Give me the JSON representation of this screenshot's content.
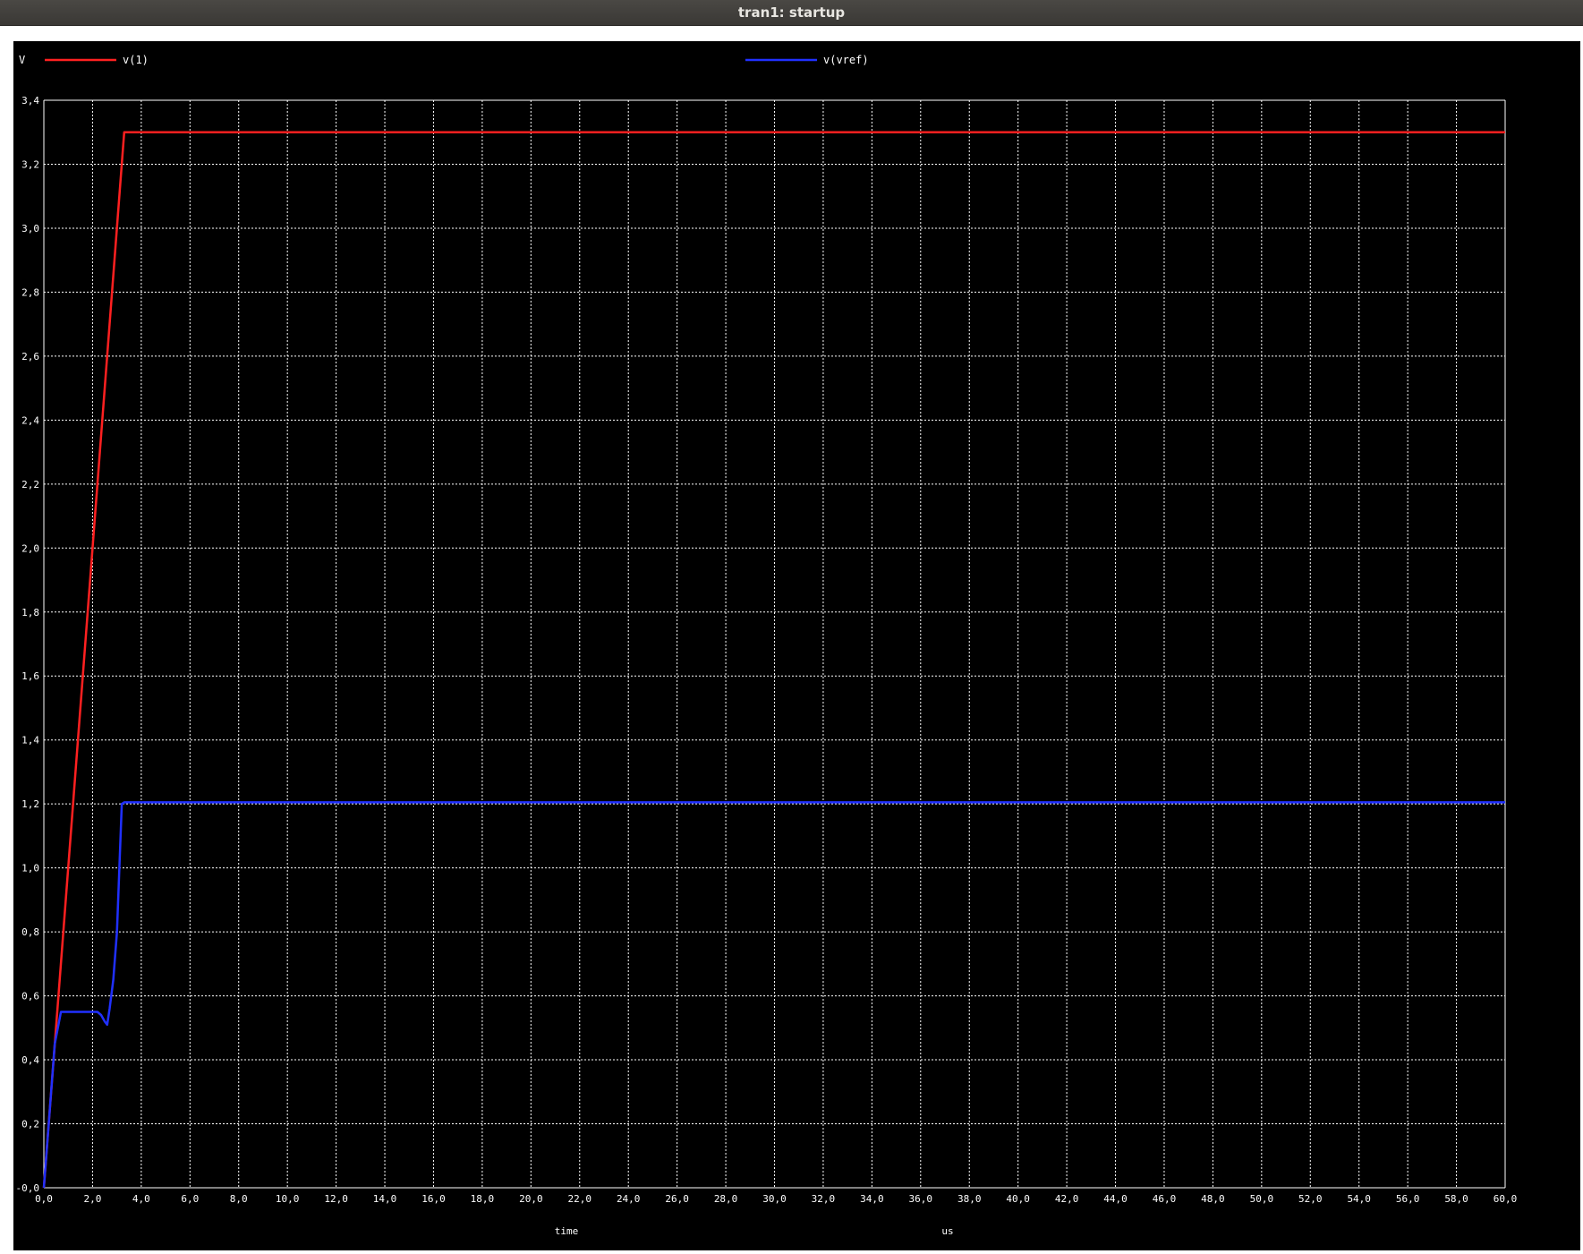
{
  "window": {
    "title": "tran1: startup"
  },
  "chart_data": {
    "type": "line",
    "ylabel": "V",
    "xlabel": "time",
    "xunit": "us",
    "xlim": [
      0,
      60
    ],
    "ylim": [
      0,
      3.4
    ],
    "x_ticks": [
      0,
      2,
      4,
      6,
      8,
      10,
      12,
      14,
      16,
      18,
      20,
      22,
      24,
      26,
      28,
      30,
      32,
      34,
      36,
      38,
      40,
      42,
      44,
      46,
      48,
      50,
      52,
      54,
      56,
      58,
      60
    ],
    "x_tick_labels": [
      "0,0",
      "2,0",
      "4,0",
      "6,0",
      "8,0",
      "10,0",
      "12,0",
      "14,0",
      "16,0",
      "18,0",
      "20,0",
      "22,0",
      "24,0",
      "26,0",
      "28,0",
      "30,0",
      "32,0",
      "34,0",
      "36,0",
      "38,0",
      "40,0",
      "42,0",
      "44,0",
      "46,0",
      "48,0",
      "50,0",
      "52,0",
      "54,0",
      "56,0",
      "58,0",
      "60,0"
    ],
    "y_ticks": [
      0,
      0.2,
      0.4,
      0.6,
      0.8,
      1.0,
      1.2,
      1.4,
      1.6,
      1.8,
      2.0,
      2.2,
      2.4,
      2.6,
      2.8,
      3.0,
      3.2,
      3.4
    ],
    "y_tick_labels": [
      "-0,0",
      "0,2",
      "0,4",
      "0,6",
      "0,8",
      "1,0",
      "1,2",
      "1,4",
      "1,6",
      "1,8",
      "2,0",
      "2,2",
      "2,4",
      "2,6",
      "2,8",
      "3,0",
      "3,2",
      "3,4"
    ],
    "grid": true,
    "colors": {
      "background": "#000000",
      "grid": "#ffffff",
      "axis_text": "#ffffff"
    },
    "series": [
      {
        "name": "v(1)",
        "color": "#ff2020",
        "x": [
          0,
          3.3,
          60
        ],
        "y": [
          0,
          3.3,
          3.3
        ]
      },
      {
        "name": "v(vref)",
        "color": "#2030ff",
        "x": [
          0,
          0.25,
          0.45,
          0.7,
          0.85,
          2.2,
          2.35,
          2.5,
          2.6,
          2.7,
          2.85,
          3.0,
          3.1,
          3.2,
          3.3,
          60
        ],
        "y": [
          0,
          0.25,
          0.45,
          0.55,
          0.55,
          0.55,
          0.54,
          0.52,
          0.51,
          0.56,
          0.65,
          0.8,
          1.0,
          1.2,
          1.205,
          1.205
        ]
      }
    ]
  }
}
